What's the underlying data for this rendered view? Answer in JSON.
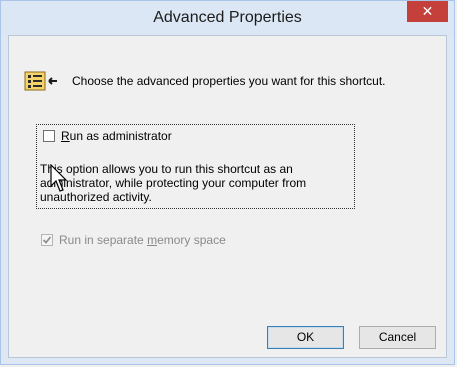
{
  "window": {
    "title": "Advanced Properties",
    "close_label": "✕"
  },
  "header": {
    "text": "Choose the advanced properties you want for this shortcut.",
    "icon": "shortcut-properties-icon"
  },
  "options": {
    "run_as_admin": {
      "label_prefix": "R",
      "label_rest": "un as administrator",
      "checked": false,
      "description": "This option allows you to run this shortcut as an administrator, while protecting your computer from unauthorized activity."
    },
    "separate_memory": {
      "label_prefix": "Run in separate ",
      "label_mnemonic": "m",
      "label_rest": "emory space",
      "checked": true,
      "enabled": false
    }
  },
  "buttons": {
    "ok": "OK",
    "cancel": "Cancel"
  },
  "colors": {
    "close_button": "#c6403b",
    "titlebar": "#dbe7f4",
    "dialog_bg": "#f0f0f0"
  }
}
